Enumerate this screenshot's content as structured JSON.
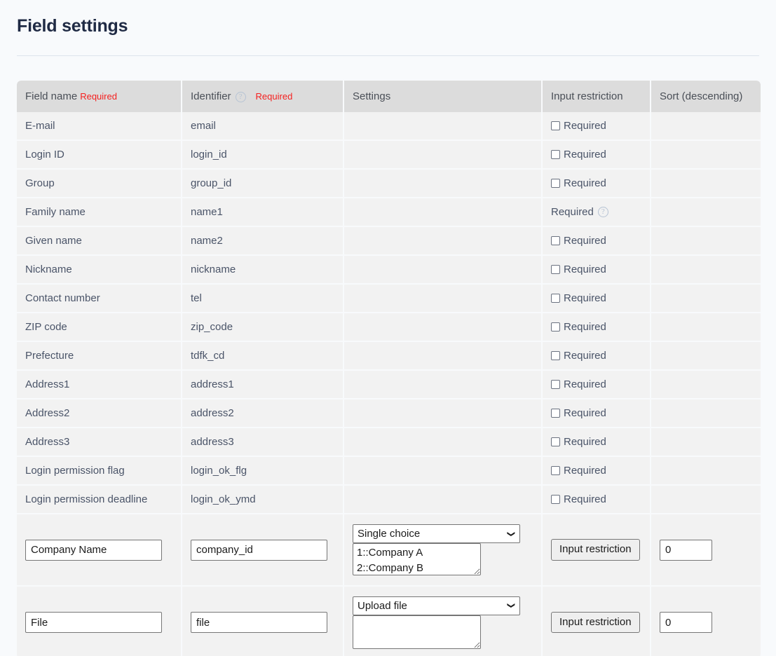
{
  "page": {
    "title": "Field settings"
  },
  "table": {
    "columns": [
      {
        "label": "Field name",
        "required_tag": "Required",
        "has_help_icon": false
      },
      {
        "label": "Identifier",
        "required_tag": "Required",
        "has_help_icon": true
      },
      {
        "label": "Settings",
        "required_tag": "",
        "has_help_icon": false
      },
      {
        "label": "Input restriction",
        "required_tag": "",
        "has_help_icon": false
      },
      {
        "label": "Sort (descending)",
        "required_tag": "",
        "has_help_icon": false
      }
    ],
    "checkbox_label": "Required",
    "help_icon": "help-circle-icon",
    "rows": [
      {
        "field_name": "E-mail",
        "identifier": "email",
        "restriction_type": "checkbox",
        "restriction_label": "Required",
        "checked": false
      },
      {
        "field_name": "Login ID",
        "identifier": "login_id",
        "restriction_type": "checkbox",
        "restriction_label": "Required",
        "checked": false
      },
      {
        "field_name": "Group",
        "identifier": "group_id",
        "restriction_type": "checkbox",
        "restriction_label": "Required",
        "checked": false
      },
      {
        "field_name": "Family name",
        "identifier": "name1",
        "restriction_type": "static",
        "restriction_label": "Required",
        "checked": false
      },
      {
        "field_name": "Given name",
        "identifier": "name2",
        "restriction_type": "checkbox",
        "restriction_label": "Required",
        "checked": false
      },
      {
        "field_name": "Nickname",
        "identifier": "nickname",
        "restriction_type": "checkbox",
        "restriction_label": "Required",
        "checked": false
      },
      {
        "field_name": "Contact number",
        "identifier": "tel",
        "restriction_type": "checkbox",
        "restriction_label": "Required",
        "checked": false
      },
      {
        "field_name": "ZIP code",
        "identifier": "zip_code",
        "restriction_type": "checkbox",
        "restriction_label": "Required",
        "checked": false
      },
      {
        "field_name": "Prefecture",
        "identifier": "tdfk_cd",
        "restriction_type": "checkbox",
        "restriction_label": "Required",
        "checked": false
      },
      {
        "field_name": "Address1",
        "identifier": "address1",
        "restriction_type": "checkbox",
        "restriction_label": "Required",
        "checked": false
      },
      {
        "field_name": "Address2",
        "identifier": "address2",
        "restriction_type": "checkbox",
        "restriction_label": "Required",
        "checked": false
      },
      {
        "field_name": "Address3",
        "identifier": "address3",
        "restriction_type": "checkbox",
        "restriction_label": "Required",
        "checked": false
      },
      {
        "field_name": "Login permission flag",
        "identifier": "login_ok_flg",
        "restriction_type": "checkbox",
        "restriction_label": "Required",
        "checked": false
      },
      {
        "field_name": "Login permission deadline",
        "identifier": "login_ok_ymd",
        "restriction_type": "checkbox",
        "restriction_label": "Required",
        "checked": false
      }
    ],
    "editable_rows": [
      {
        "field_name_value": "Company Name",
        "identifier_value": "company_id",
        "type_selected": "Single choice",
        "type_options": [
          "Single choice"
        ],
        "options_value": "1::Company A\n2::Company B",
        "restriction_button": "Input restriction",
        "sort_value": "0"
      },
      {
        "field_name_value": "File",
        "identifier_value": "file",
        "type_selected": "Upload file",
        "type_options": [
          "Upload file"
        ],
        "options_value": "",
        "restriction_button": "Input restriction",
        "sort_value": "0"
      }
    ]
  },
  "colors": {
    "page_bg": "#f8fafc",
    "header_bg": "#dcdcdc",
    "cell_bg": "#f2f2f2",
    "required_red": "#f5201f",
    "text": "#4a5468",
    "title": "#1f2a44"
  }
}
